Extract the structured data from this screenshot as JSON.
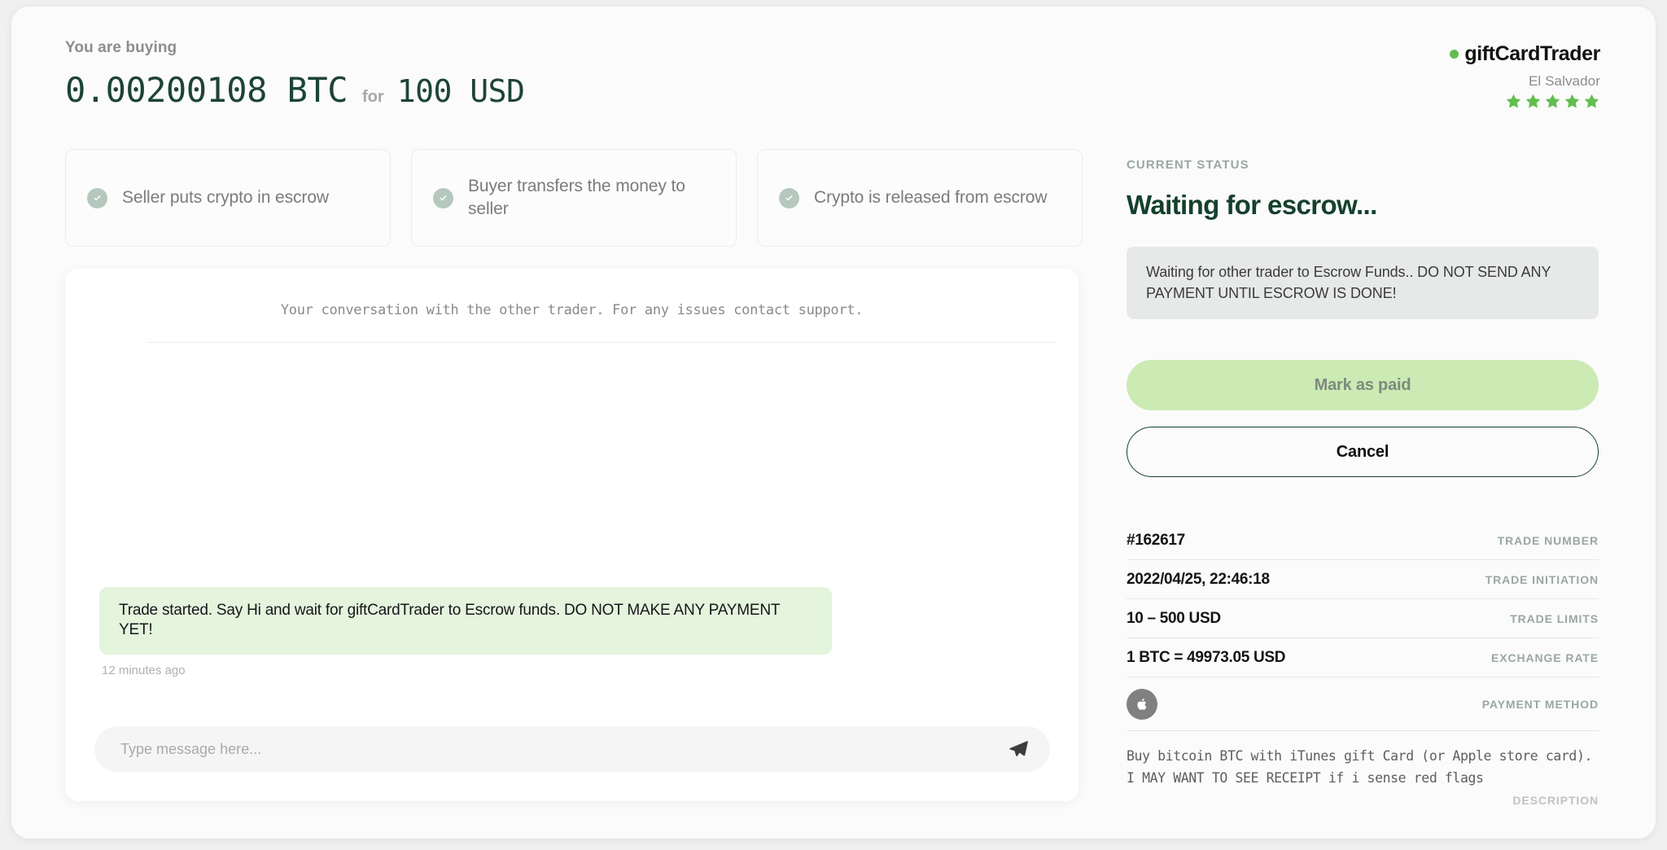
{
  "header": {
    "buying_label": "You are buying",
    "crypto_amount": "0.00200108 BTC",
    "for_label": "for",
    "fiat_amount": "100 USD"
  },
  "brand": {
    "dot_icon": "status-dot-icon",
    "name": "giftCardTrader",
    "country": "El Salvador",
    "stars": 5,
    "star_color": "#62bd4f",
    "dot_color": "#62bd4f"
  },
  "steps": [
    {
      "icon": "check-circle-icon",
      "label": "Seller puts crypto in escrow"
    },
    {
      "icon": "check-circle-icon",
      "label": "Buyer transfers the money to seller"
    },
    {
      "icon": "check-circle-icon",
      "label": "Crypto is released from escrow"
    }
  ],
  "chat": {
    "intro": "Your conversation with the other trader. For any issues contact support.",
    "message": "Trade started. Say Hi and wait for giftCardTrader to Escrow funds. DO NOT MAKE ANY PAYMENT YET!",
    "message_time": "12 minutes ago",
    "input_value": "",
    "input_placeholder": "Type message here...",
    "send_icon": "send-paper-plane-icon",
    "bubble_color": "#e4f4dd"
  },
  "status": {
    "eyebrow": "CURRENT STATUS",
    "title": "Waiting for escrow...",
    "note": "Waiting for other trader to Escrow Funds.. DO NOT SEND ANY PAYMENT UNTIL ESCROW IS DONE!"
  },
  "actions": {
    "mark_paid_label": "Mark as paid",
    "cancel_label": "Cancel",
    "mark_paid_color": "#cbeab4"
  },
  "details": [
    {
      "value": "#162617",
      "key": "TRADE NUMBER"
    },
    {
      "value": "2022/04/25, 22:46:18",
      "key": "TRADE INITIATION"
    },
    {
      "value": "10 – 500 USD",
      "key": "TRADE LIMITS"
    },
    {
      "value": "1 BTC = 49973.05 USD",
      "key": "EXCHANGE RATE"
    }
  ],
  "payment": {
    "icon": "apple-logo-icon",
    "key": "PAYMENT METHOD"
  },
  "description": {
    "text": "Buy bitcoin BTC with iTunes gift Card (or Apple store card).\nI MAY WANT TO SEE RECEIPT if i sense red flags",
    "key": "DESCRIPTION"
  }
}
